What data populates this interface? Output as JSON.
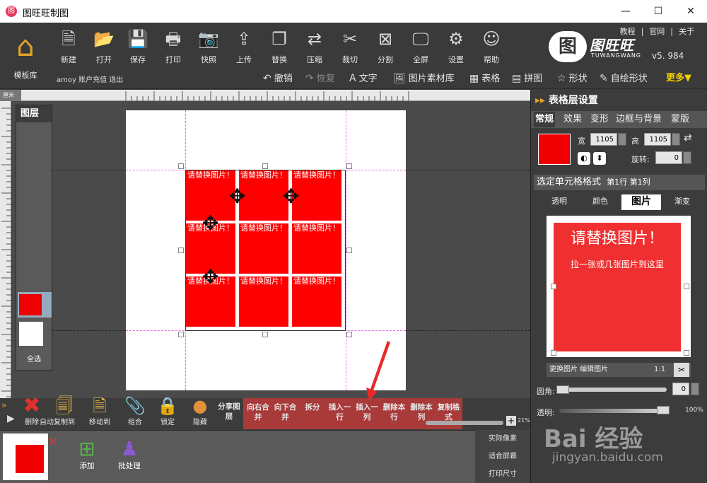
{
  "app": {
    "title": "图旺旺制图",
    "icon": "app-logo-icon"
  },
  "window_controls": {
    "minimize": "—",
    "maximize": "☐",
    "close": "✕"
  },
  "toolbar": {
    "home": "模板库",
    "tools": [
      {
        "name": "new",
        "label": "新建",
        "glyph": "🗎"
      },
      {
        "name": "open",
        "label": "打开",
        "glyph": "📂"
      },
      {
        "name": "save",
        "label": "保存",
        "glyph": "💾"
      },
      {
        "name": "print",
        "label": "打印",
        "glyph": "🖶"
      },
      {
        "name": "snapshot",
        "label": "快照",
        "glyph": "📷"
      },
      {
        "name": "upload",
        "label": "上传",
        "glyph": "⇪"
      },
      {
        "name": "replace",
        "label": "替换",
        "glyph": "❐"
      },
      {
        "name": "compress",
        "label": "压缩",
        "glyph": "⇄"
      },
      {
        "name": "cut",
        "label": "裁切",
        "glyph": "✂"
      },
      {
        "name": "split",
        "label": "分割",
        "glyph": "⊠"
      },
      {
        "name": "fullscreen",
        "label": "全屏",
        "glyph": "🖵"
      },
      {
        "name": "settings",
        "label": "设置",
        "glyph": "⚙"
      },
      {
        "name": "help",
        "label": "帮助",
        "glyph": "☺"
      }
    ],
    "top_links": [
      "教程",
      "|",
      "官网",
      "|",
      "关于"
    ],
    "logo_name": "图旺旺",
    "logo_sub": "TUWANGWANG",
    "logo_mark": "图",
    "version": "v5. 984",
    "account": "amoy 账户充值 退出",
    "secondary": [
      {
        "name": "undo",
        "label": "撤销",
        "glyph": "↶",
        "disabled": false
      },
      {
        "name": "redo",
        "label": "恢复",
        "glyph": "↷",
        "disabled": true
      },
      {
        "name": "text",
        "label": "文字",
        "glyph": "A",
        "disabled": false
      },
      {
        "name": "image-library",
        "label": "图片素材库",
        "glyph": "🖼",
        "disabled": false
      },
      {
        "name": "table",
        "label": "表格",
        "glyph": "▦",
        "disabled": false
      },
      {
        "name": "collage",
        "label": "拼图",
        "glyph": "▤",
        "disabled": false
      },
      {
        "name": "shape",
        "label": "形状",
        "glyph": "☆",
        "disabled": false
      },
      {
        "name": "custom-shape",
        "label": "自绘形状",
        "glyph": "✎",
        "disabled": false
      }
    ],
    "more": "更多▼"
  },
  "ruler": {
    "unit": "厘米"
  },
  "layers": {
    "title": "图层",
    "select_all": "全选"
  },
  "canvas": {
    "cell_text": "请替换图片！",
    "rows": 3,
    "cols": 3
  },
  "actions": {
    "delete": "删除",
    "copy_to": "复制到",
    "move_to": "移动到",
    "group": "组合",
    "lock": "锁定",
    "hide": "隐藏",
    "share_layer": "分享图层",
    "auto": "自动",
    "zoom_pct": "21%"
  },
  "merge_group": [
    {
      "name": "merge-right",
      "label": "向右合并"
    },
    {
      "name": "merge-down",
      "label": "向下合并"
    },
    {
      "name": "split-cell",
      "label": "拆分"
    },
    {
      "name": "insert-row",
      "label": "插入一行"
    },
    {
      "name": "insert-col",
      "label": "插入一列"
    },
    {
      "name": "delete-row",
      "label": "删除本行"
    },
    {
      "name": "delete-col",
      "label": "删除本列"
    },
    {
      "name": "copy-format",
      "label": "复制格式"
    }
  ],
  "bottom": {
    "add": "添加",
    "batch": "批处理",
    "view_options": [
      "实际像素",
      "适合屏幕",
      "打印尺寸"
    ]
  },
  "panel": {
    "title": "表格层设置",
    "tabs": [
      "常规",
      "效果",
      "变形",
      "边框与背景",
      "蒙版"
    ],
    "width_label": "宽",
    "width_value": "1105",
    "height_label": "高",
    "height_value": "1105",
    "rotate_label": "旋转:",
    "rotate_value": "0",
    "cell_format": "选定单元格格式",
    "cell_pos": "第1行  第1列",
    "subtabs": [
      "透明",
      "颜色",
      "图片",
      "渐变"
    ],
    "image_big": "请替换图片！",
    "image_small": "拉一张或几张图片到这里",
    "image_buttons": "更换图片  编辑图片",
    "ratio": "1:1",
    "corner_label": "圆角:",
    "corner_value": "0",
    "opacity_label": "透明:",
    "opacity_value": "100%",
    "watermark": "Bai 经验",
    "watermark_url": "jingyan.baidu.com"
  },
  "colors": {
    "accent_red": "#ff0000",
    "more_yellow": "#f1d000",
    "bg_dark": "#3c3c3c"
  }
}
